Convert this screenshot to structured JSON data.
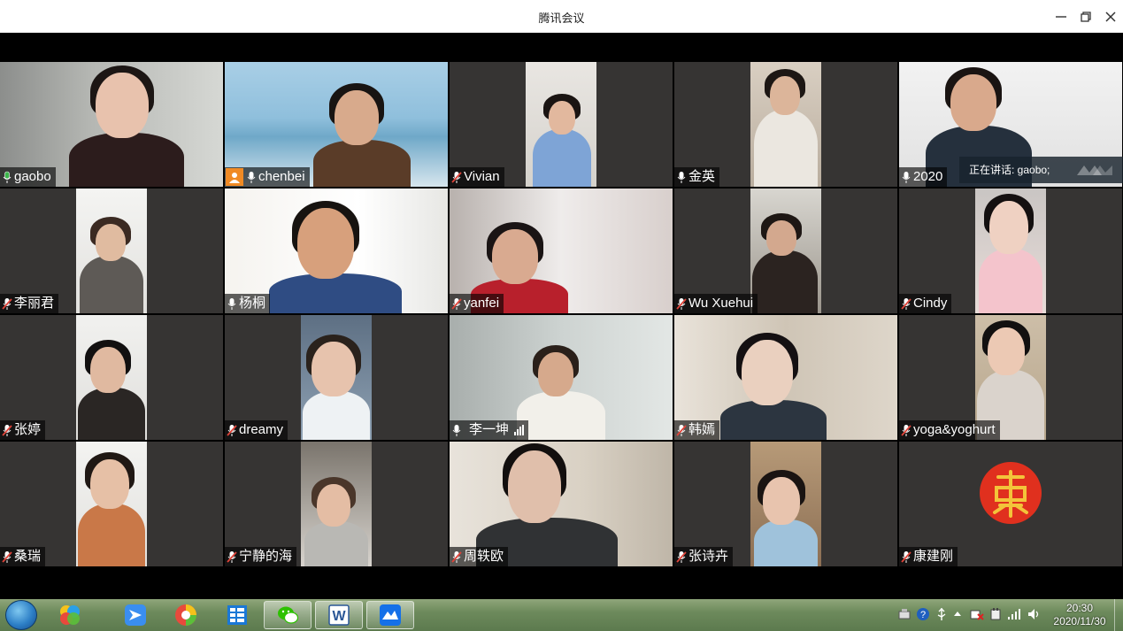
{
  "window": {
    "title": "腾讯会议",
    "minimize_icon": "minimize-icon",
    "restore_icon": "restore-icon",
    "close_icon": "close-icon"
  },
  "speaking": {
    "label": "正在讲话: gaobo;"
  },
  "participants": [
    {
      "name": "gaobo",
      "mic": "on",
      "active": true
    },
    {
      "name": "chenbei",
      "mic": "on",
      "host": true
    },
    {
      "name": "Vivian",
      "mic": "muted"
    },
    {
      "name": "金英",
      "mic": "on"
    },
    {
      "name": "2020",
      "mic": "on"
    },
    {
      "name": "李丽君",
      "mic": "muted"
    },
    {
      "name": "杨桐",
      "mic": "on"
    },
    {
      "name": "yanfei",
      "mic": "muted"
    },
    {
      "name": "Wu Xuehui",
      "mic": "muted"
    },
    {
      "name": "Cindy",
      "mic": "muted"
    },
    {
      "name": "张婷",
      "mic": "muted"
    },
    {
      "name": "dreamy",
      "mic": "muted"
    },
    {
      "name": "李一坤",
      "mic": "on",
      "signal": true
    },
    {
      "name": "韩嫣",
      "mic": "muted"
    },
    {
      "name": "yoga&yoghurt",
      "mic": "muted"
    },
    {
      "name": "桑瑞",
      "mic": "muted"
    },
    {
      "name": "宁静的海",
      "mic": "muted"
    },
    {
      "name": "周轶欧",
      "mic": "muted"
    },
    {
      "name": "张诗卉",
      "mic": "muted"
    },
    {
      "name": "康建刚",
      "mic": "muted",
      "avatar": "seal-logo"
    }
  ],
  "taskbar": {
    "apps": [
      "start-orb",
      "app-360-icon",
      "app-feishu-icon",
      "app-360browser-icon",
      "app-files-icon",
      "app-wechat-icon",
      "app-word-icon",
      "app-tencent-meeting-icon"
    ],
    "tray_icons": [
      "network-icon",
      "help-icon",
      "usb-icon",
      "expand-tray-icon",
      "security-alert-icon",
      "power-icon",
      "signal-icon",
      "volume-icon"
    ],
    "clock_time": "20:30",
    "clock_date": "2020/11/30"
  },
  "colors": {
    "tile_bg": "#363433",
    "active_border": "#3bb54a",
    "host_badge": "#f08a24",
    "muted_mic": "#e0443a"
  }
}
